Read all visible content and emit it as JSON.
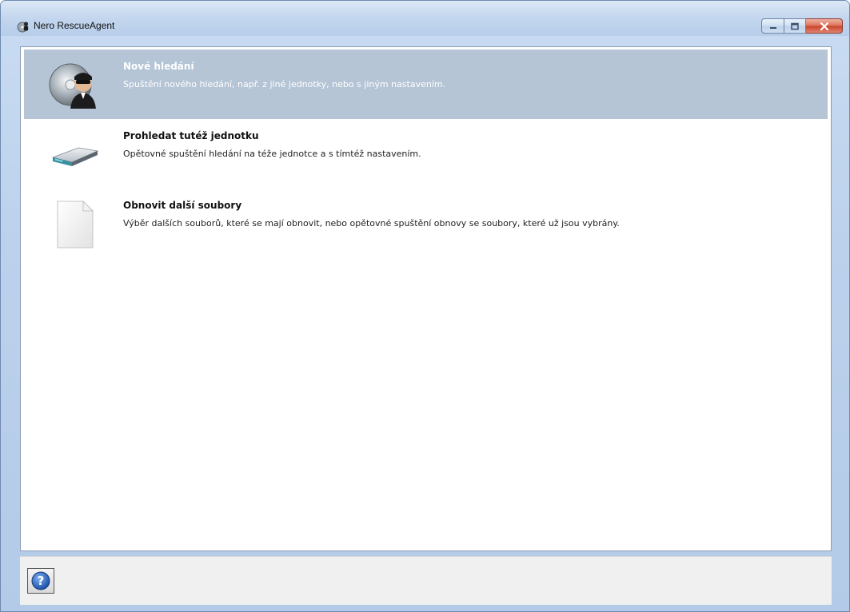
{
  "window": {
    "title": "Nero RescueAgent"
  },
  "caption_buttons": {
    "minimize_icon": "minimize-icon",
    "maximize_icon": "maximize-icon",
    "close_icon": "close-icon"
  },
  "options": [
    {
      "title": "Nové hledání",
      "description": "Spuštění nového hledání, např. z jiné jednotky, nebo s jiným nastavením.",
      "icon": "disc-agent-icon",
      "selected": true
    },
    {
      "title": "Prohledat tutéž jednotku",
      "description": "Opětovné spuštění hledání na téže jednotce a s tímtéž nastavením.",
      "icon": "drive-icon",
      "selected": false
    },
    {
      "title": "Obnovit další soubory",
      "description": "Výběr dalších souborů, které se mají obnovit, nebo opětovné spuštění obnovy se soubory, které už jsou vybrány.",
      "icon": "document-icon",
      "selected": false
    }
  ],
  "help": {
    "icon": "help-icon"
  },
  "colors": {
    "selection": "#b5c5d6",
    "titlebar": "#c3d6ee",
    "close_button": "#c8432b"
  }
}
